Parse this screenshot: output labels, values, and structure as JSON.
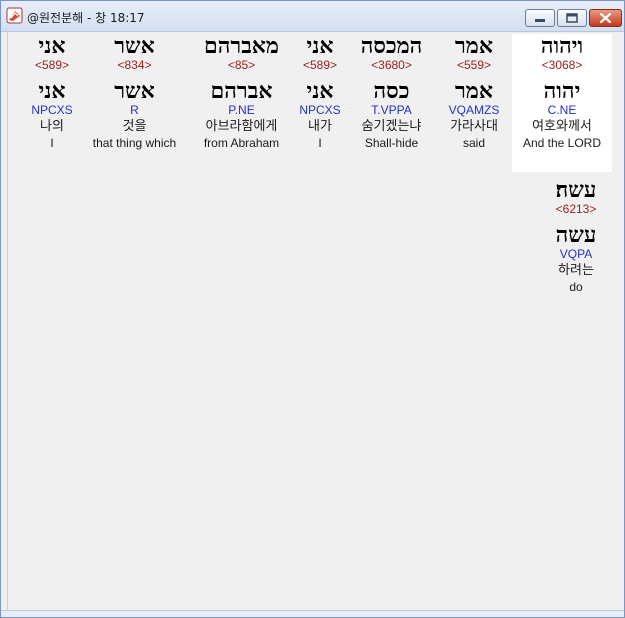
{
  "window": {
    "title": "@원전분해 - 창 18:17",
    "minimize_label": "Minimize",
    "maximize_label": "Maximize",
    "close_label": "Close"
  },
  "words": [
    {
      "hebrew": "ויהוה",
      "strong": "<3068>",
      "lemma": "יהוה",
      "parse": "C.NE",
      "korean": "여호와께서",
      "english": "And the LORD",
      "selected": true
    },
    {
      "hebrew": "אמר",
      "strong": "<559>",
      "lemma": "אמר",
      "parse": "VQAMZS",
      "korean": "가라사대",
      "english": "said",
      "selected": false
    },
    {
      "hebrew": "המכסה",
      "strong": "<3680>",
      "lemma": "כסה",
      "parse": "T.VPPA",
      "korean": "숨기겠는냐",
      "english": "Shall-hide",
      "selected": false
    },
    {
      "hebrew": "אני",
      "strong": "<589>",
      "lemma": "אני",
      "parse": "NPCXS",
      "korean": "내가",
      "english": "I",
      "selected": false
    },
    {
      "hebrew": "מאברהם",
      "strong": "<85>",
      "lemma": "אברהם",
      "parse": "P.NE",
      "korean": "아브라함에게",
      "english": "from Abraham",
      "selected": false
    },
    {
      "hebrew": "אשר",
      "strong": "<834>",
      "lemma": "אשר",
      "parse": "R",
      "korean": "것을",
      "english": "that thing which",
      "selected": false
    },
    {
      "hebrew": "אני",
      "strong": "<589>",
      "lemma": "אני",
      "parse": "NPCXS",
      "korean": "나의",
      "english": "I",
      "selected": false
    },
    {
      "hebrew": "עשה׃",
      "strong": "<6213>",
      "lemma": "עשה",
      "parse": "VQPA",
      "korean": "하려는",
      "english": "do",
      "selected": false
    }
  ]
}
